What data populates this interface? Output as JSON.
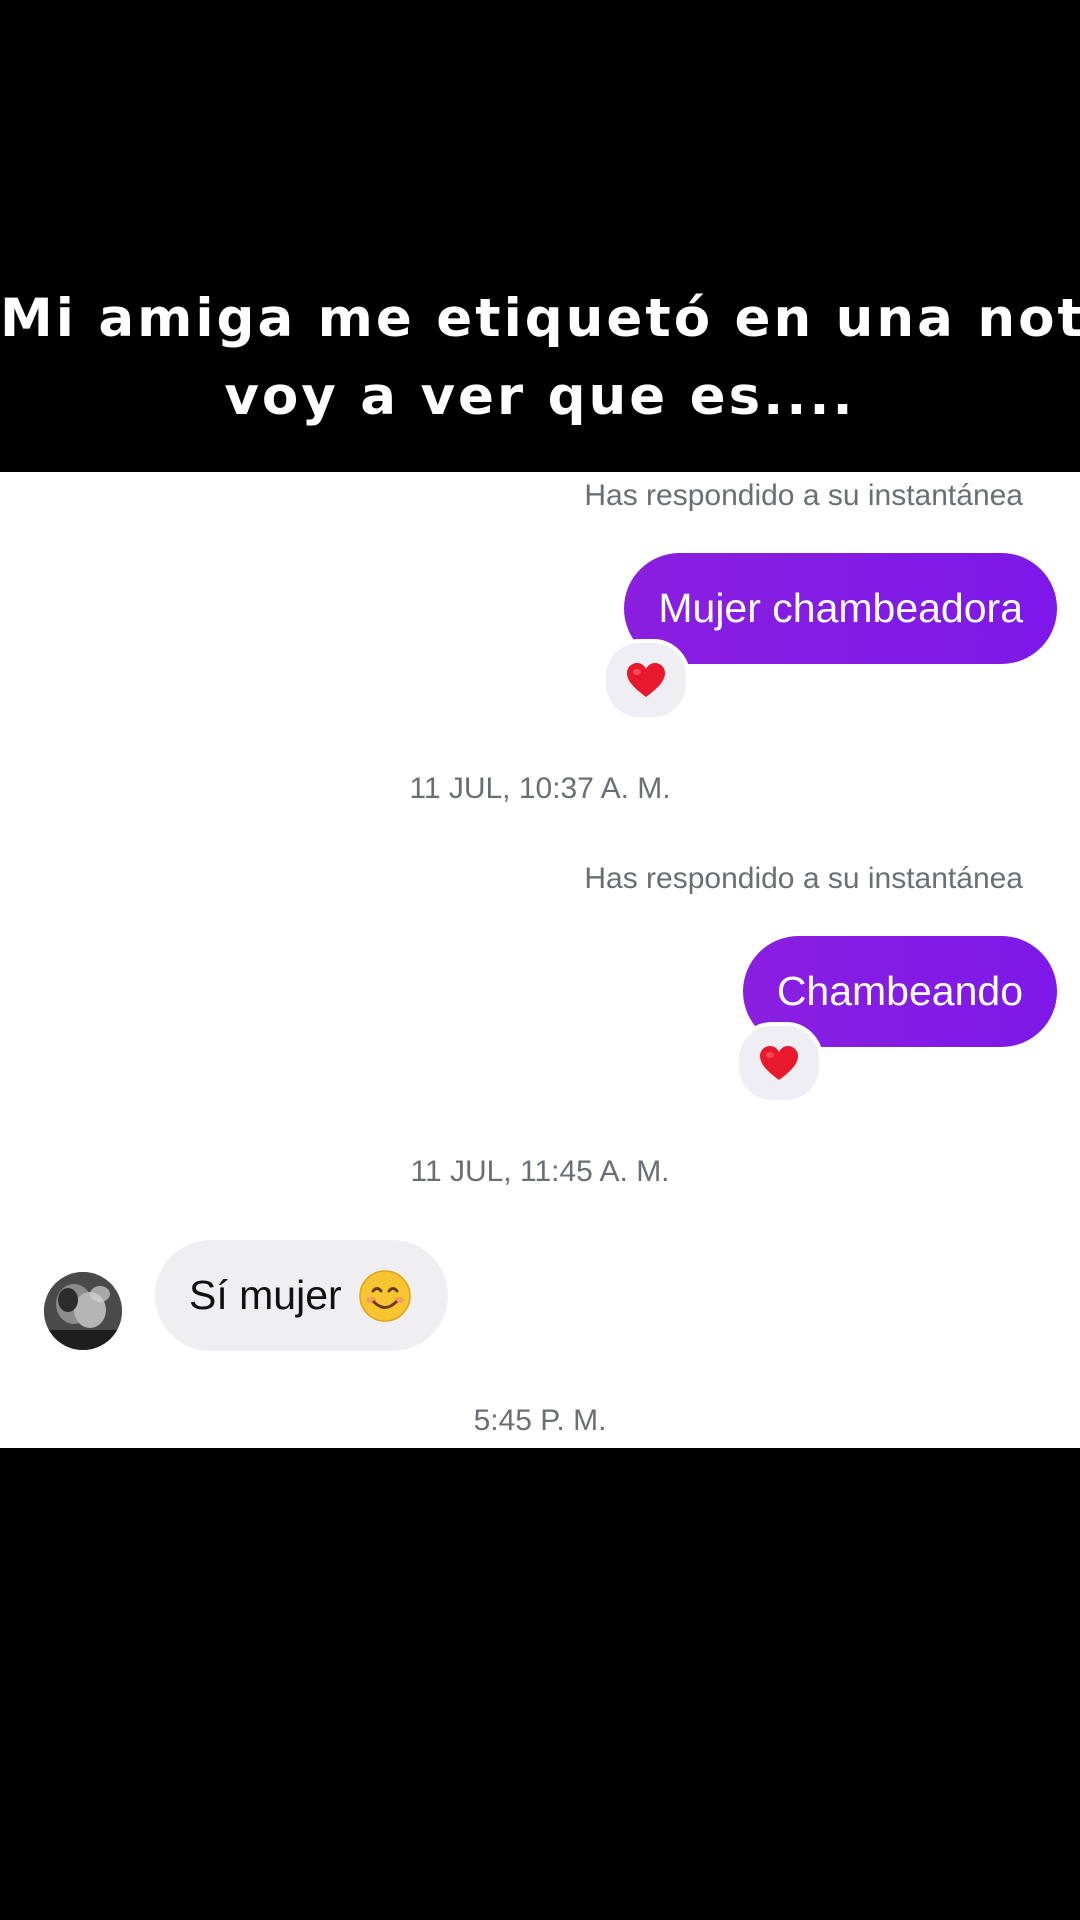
{
  "caption": {
    "line1": "Mi amiga me etiquetó en una nota",
    "line2": "voy a ver que es...."
  },
  "chat": {
    "messages": [
      {
        "reply_context": "Has respondido a su instantánea",
        "text": "Mujer chambeadora",
        "direction": "outgoing",
        "reaction": "heart-icon"
      },
      {
        "timestamp": "11 JUL, 10:37 A. M."
      },
      {
        "reply_context": "Has respondido a su instantánea",
        "text": "Chambeando",
        "direction": "outgoing",
        "reaction": "heart-icon"
      },
      {
        "timestamp": "11 JUL, 11:45 A. M."
      },
      {
        "text": "Sí mujer",
        "emoji": "smiling-face-icon",
        "direction": "incoming"
      },
      {
        "timestamp": "5:45 P. M."
      }
    ]
  },
  "colors": {
    "outgoing_bubble": "#8a1fe0",
    "incoming_bubble": "#efeff2",
    "meta_text": "#6b6e73",
    "background": "#000000",
    "chat_background": "#ffffff",
    "heart": "#e8192c"
  }
}
